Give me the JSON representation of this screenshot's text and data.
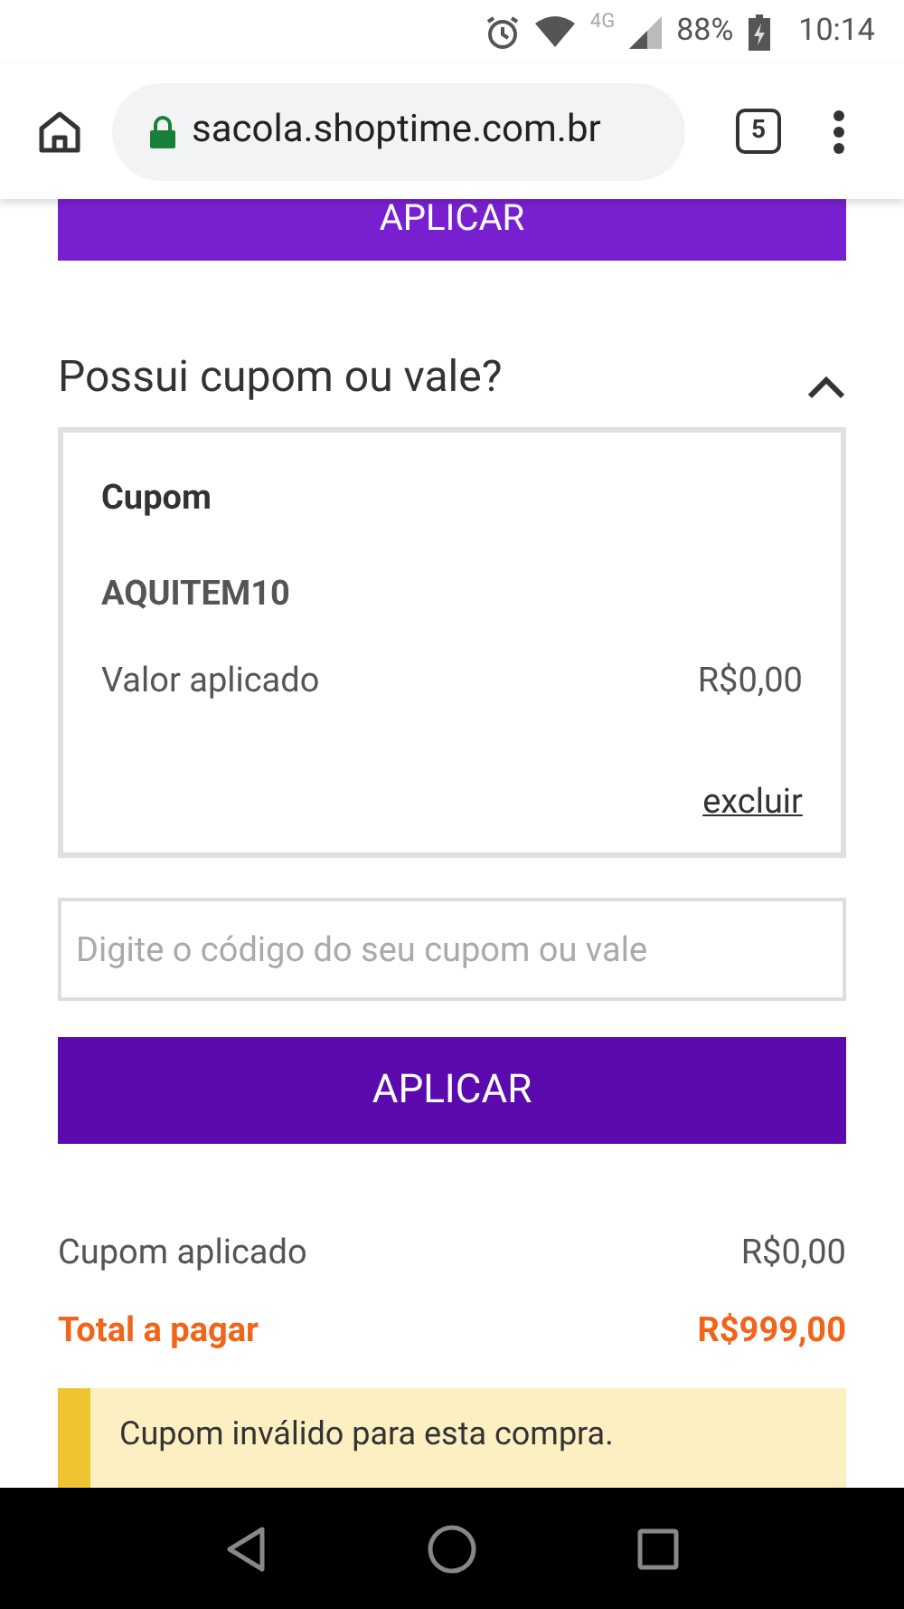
{
  "status_bar": {
    "network": "4G",
    "battery": "88%",
    "time": "10:14"
  },
  "browser": {
    "url": "sacola.shoptime.com.br",
    "tab_count": "5"
  },
  "top_button": "APLICAR",
  "coupon_section": {
    "title": "Possui cupom ou vale?",
    "expanded": true,
    "applied_coupon": {
      "label": "Cupom",
      "code": "AQUITEM10",
      "value_label": "Valor aplicado",
      "value": "R$0,00",
      "remove_link": "excluir"
    },
    "input": {
      "placeholder": "Digite o código do seu cupom ou vale"
    },
    "apply_button": "APLICAR"
  },
  "summary": [
    {
      "kind": "normal",
      "label": "Cupom aplicado",
      "value": "R$0,00"
    },
    {
      "kind": "total",
      "label": "Total a pagar",
      "value": "R$999,00"
    }
  ],
  "alert": {
    "message": "Cupom inválido para esta compra."
  }
}
